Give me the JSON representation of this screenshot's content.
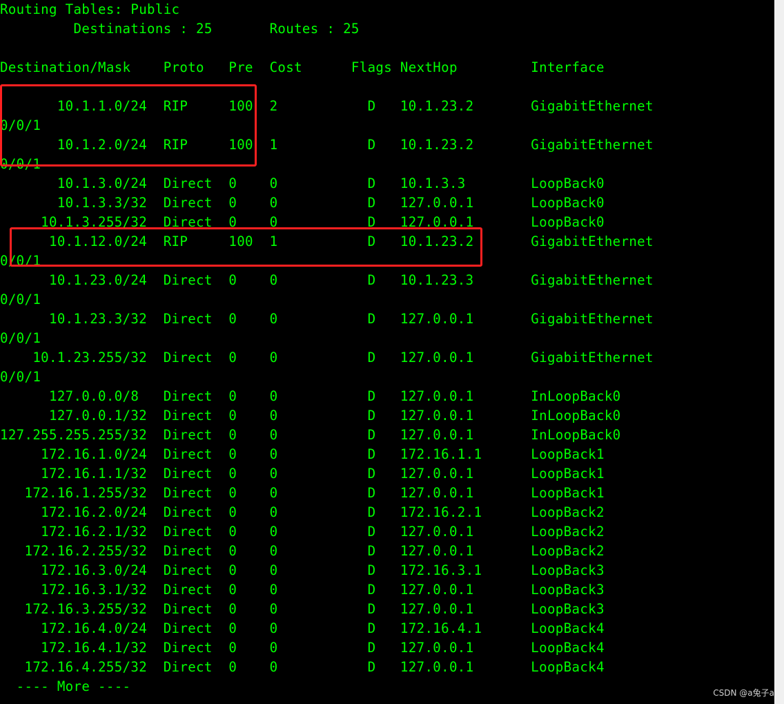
{
  "terminal": {
    "text_color": "#00ff00",
    "background": "#000000",
    "highlight_color": "#ff2020",
    "lines": [
      "Routing Tables: Public",
      "         Destinations : 25       Routes : 25",
      "",
      "Destination/Mask    Proto   Pre  Cost      Flags NextHop         Interface",
      "",
      "       10.1.1.0/24  RIP     100  2           D   10.1.23.2       GigabitEthernet",
      "0/0/1",
      "       10.1.2.0/24  RIP     100  1           D   10.1.23.2       GigabitEthernet",
      "0/0/1",
      "       10.1.3.0/24  Direct  0    0           D   10.1.3.3        LoopBack0",
      "       10.1.3.3/32  Direct  0    0           D   127.0.0.1       LoopBack0",
      "     10.1.3.255/32  Direct  0    0           D   127.0.0.1       LoopBack0",
      "      10.1.12.0/24  RIP     100  1           D   10.1.23.2       GigabitEthernet",
      "0/0/1",
      "      10.1.23.0/24  Direct  0    0           D   10.1.23.3       GigabitEthernet",
      "0/0/1",
      "      10.1.23.3/32  Direct  0    0           D   127.0.0.1       GigabitEthernet",
      "0/0/1",
      "    10.1.23.255/32  Direct  0    0           D   127.0.0.1       GigabitEthernet",
      "0/0/1",
      "      127.0.0.0/8   Direct  0    0           D   127.0.0.1       InLoopBack0",
      "      127.0.0.1/32  Direct  0    0           D   127.0.0.1       InLoopBack0",
      "127.255.255.255/32  Direct  0    0           D   127.0.0.1       InLoopBack0",
      "     172.16.1.0/24  Direct  0    0           D   172.16.1.1      LoopBack1",
      "     172.16.1.1/32  Direct  0    0           D   127.0.0.1       LoopBack1",
      "   172.16.1.255/32  Direct  0    0           D   127.0.0.1       LoopBack1",
      "     172.16.2.0/24  Direct  0    0           D   172.16.2.1      LoopBack2",
      "     172.16.2.1/32  Direct  0    0           D   127.0.0.1       LoopBack2",
      "   172.16.2.255/32  Direct  0    0           D   127.0.0.1       LoopBack2",
      "     172.16.3.0/24  Direct  0    0           D   172.16.3.1      LoopBack3",
      "     172.16.3.1/32  Direct  0    0           D   127.0.0.1       LoopBack3",
      "   172.16.3.255/32  Direct  0    0           D   127.0.0.1       LoopBack3",
      "     172.16.4.0/24  Direct  0    0           D   172.16.4.1      LoopBack4",
      "     172.16.4.1/32  Direct  0    0           D   127.0.0.1       LoopBack4",
      "   172.16.4.255/32  Direct  0    0           D   127.0.0.1       LoopBack4",
      "  ---- More ----"
    ]
  },
  "watermark": "CSDN @a兔子a"
}
